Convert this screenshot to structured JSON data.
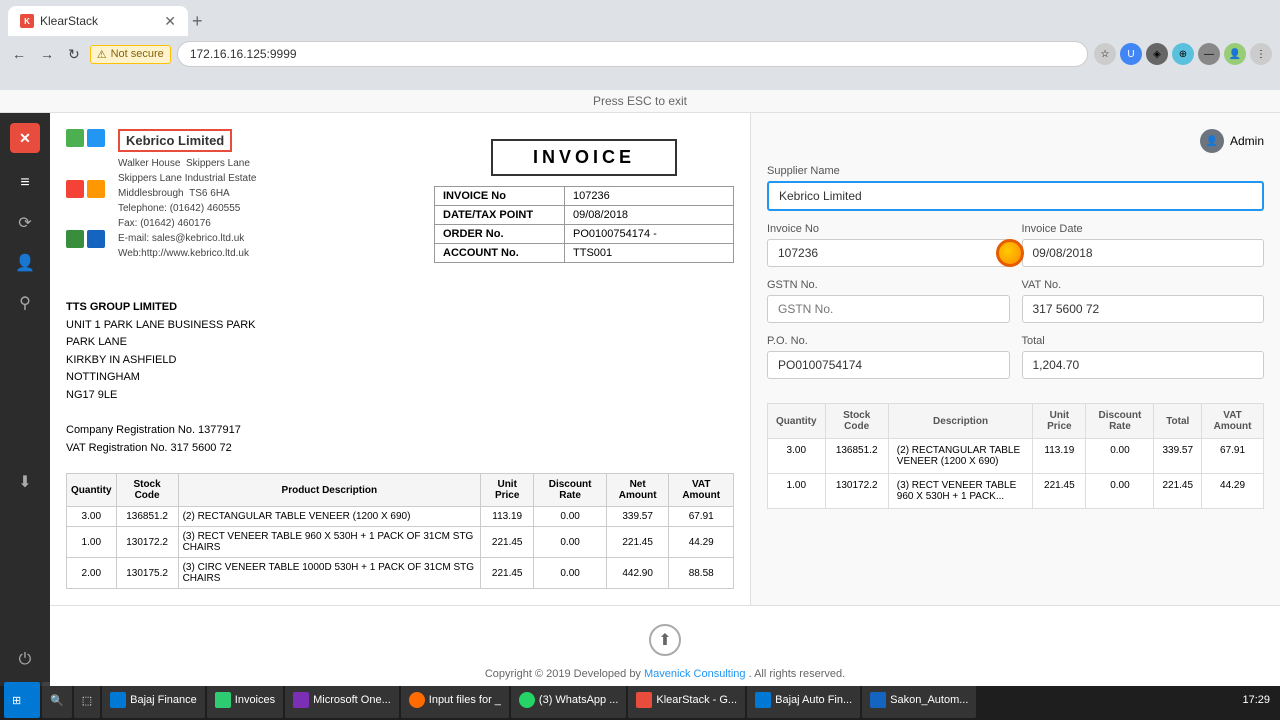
{
  "browser": {
    "tab_title": "KlearStack",
    "tab_favicon": "K",
    "address": "172.16.16.125:9999",
    "security_label": "Not secure",
    "new_tab_symbol": "+"
  },
  "esc_bar": {
    "message": "Press ESC to exit"
  },
  "sidebar": {
    "logo_letter": "X",
    "icons": [
      "≡",
      "⟳",
      "👤",
      "⚲",
      "⬇"
    ]
  },
  "admin": {
    "label": "Admin"
  },
  "document": {
    "company_name": "Kebrico Limited",
    "company_address_lines": [
      "Walker House  Skippers Lane",
      "Skippers Lane Industrial Estate",
      "Middlesbrough  TS6 6HA",
      "Telephone: (01642) 460555",
      "Fax: (01642) 460176",
      "E-mail: sales@kebrico.ltd.uk",
      "Web:http://www.kebrico.ltd.uk"
    ],
    "invoice_title": "INVOICE",
    "invoice_info": [
      {
        "label": "INVOICE No",
        "value": "107236"
      },
      {
        "label": "DATE/TAX POINT",
        "value": "09/08/2018"
      },
      {
        "label": "ORDER No.",
        "value": "PO0100754174 -"
      },
      {
        "label": "ACCOUNT No.",
        "value": "TTS001"
      }
    ],
    "bill_to": {
      "company": "TTS GROUP LIMITED",
      "lines": [
        "UNIT 1 PARK LANE BUSINESS PARK",
        "PARK LANE",
        "KIRKBY IN ASHFIELD",
        "NOTTINGHAM",
        "NG17 9LE"
      ],
      "registration": "Company Registration No. 1377917",
      "vat": "VAT Registration No. 317 5600 72"
    },
    "items_headers": [
      "Quantity",
      "Stock Code",
      "Product Description",
      "Unit Price",
      "Discount Rate",
      "Net Amount",
      "VAT Amount"
    ],
    "items": [
      {
        "qty": "3.00",
        "stock": "136851.2",
        "desc": "(2) RECTANGULAR TABLE VENEER (1200 X 690)",
        "unit_price": "113.19",
        "discount": "0.00",
        "net": "339.57",
        "vat": "67.91"
      },
      {
        "qty": "1.00",
        "stock": "130172.2",
        "desc": "(3) RECT VENEER TABLE 960 X 530H + 1 PACK OF 31CM STG CHAIRS",
        "unit_price": "221.45",
        "discount": "0.00",
        "net": "221.45",
        "vat": "44.29"
      },
      {
        "qty": "2.00",
        "stock": "130175.2",
        "desc": "(3) CIRC VENEER TABLE 1000D 530H + 1 PACK OF 31CM STG CHAIRS",
        "unit_price": "221.45",
        "discount": "0.00",
        "net": "442.90",
        "vat": "88.58"
      }
    ]
  },
  "form": {
    "supplier_label": "Supplier Name",
    "supplier_value": "Kebrico Limited",
    "supplier_placeholder": "Supplier Name",
    "invoice_no_label": "Invoice No",
    "invoice_no_value": "107236",
    "invoice_date_label": "Invoice Date",
    "invoice_date_value": "09/08/2018",
    "gstn_label": "GSTN No.",
    "gstn_value": "",
    "gstn_placeholder": "GSTN No.",
    "vat_label": "VAT No.",
    "vat_value": "317 5600 72",
    "po_label": "P.O. No.",
    "po_value": "PO0100754174",
    "total_label": "Total",
    "total_value": "1,204.70"
  },
  "extracted_table": {
    "headers": [
      "Quantity",
      "Stock Code",
      "Description",
      "Unit Price",
      "Discount Rate",
      "Total",
      "VAT Amount"
    ],
    "rows": [
      {
        "qty": "3.00",
        "stock": "136851.2",
        "desc": "(2) RECTANGULAR TABLE VENEER (1200 X 690)",
        "unit_price": "113.19",
        "discount": "0.00",
        "total": "339.57",
        "vat": "67.91"
      },
      {
        "qty": "1.00",
        "stock": "130172.2",
        "desc": "(3) RECT VENEER TABLE 960 X 530H + 1 PACK...",
        "unit_price": "221.45",
        "discount": "0.00",
        "total": "221.45",
        "vat": "44.29"
      }
    ]
  },
  "footer": {
    "text": "Copyright © 2019 Developed by",
    "link_text": "Mavenick Consulting",
    "suffix": ". All rights reserved."
  },
  "taskbar": {
    "items": [
      {
        "label": "Bajaj Finance",
        "color": "#0078d4"
      },
      {
        "label": "Invoices",
        "color": "#2ecc71"
      },
      {
        "label": "Microsoft OneNote",
        "color": "#7b2fb5"
      },
      {
        "label": "Input files for _",
        "color": "#ff6b00"
      },
      {
        "label": "(3) WhatsApp ...",
        "color": "#25d366"
      },
      {
        "label": "KlearStack - G...",
        "color": "#e74c3c"
      },
      {
        "label": "Bajaj Auto Fin...",
        "color": "#0078d4"
      },
      {
        "label": "Sakon_Autom...",
        "color": "#1565c0"
      }
    ],
    "time": "17:29",
    "date": "  "
  }
}
